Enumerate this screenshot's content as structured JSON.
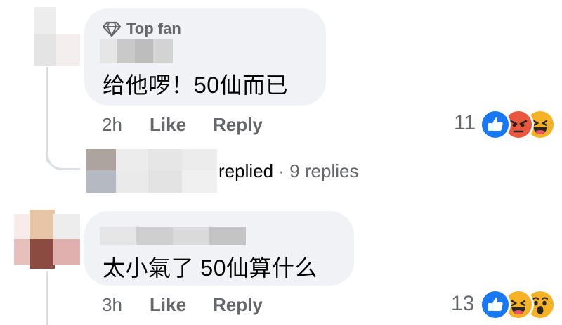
{
  "comments": [
    {
      "badge": "Top fan",
      "text": "给他啰！50仙而已",
      "time": "2h",
      "like_label": "Like",
      "reply_label": "Reply",
      "reaction_count": "11",
      "reactions": [
        "like-icon",
        "angry-icon",
        "haha-icon"
      ],
      "replies_summary": {
        "replied_word": "replied",
        "separator": "·",
        "count_text": "9 replies"
      }
    },
    {
      "text": "太小氣了 50仙算什么",
      "time": "3h",
      "like_label": "Like",
      "reply_label": "Reply",
      "reaction_count": "13",
      "reactions": [
        "like-icon",
        "haha-icon",
        "wow-icon"
      ]
    }
  ],
  "colors": {
    "bubble": "#f0f2f5",
    "secondary_text": "#65676b",
    "like_blue": "#1877f2",
    "angry_red": "#e9573f",
    "haha_yellow": "#f7b125"
  }
}
